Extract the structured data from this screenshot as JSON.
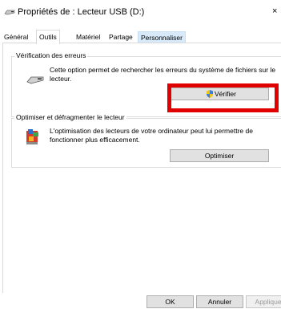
{
  "window": {
    "title": "Propriétés de : Lecteur USB (D:)",
    "close_glyph": "×"
  },
  "tabs": [
    {
      "label": "Général"
    },
    {
      "label": "Outils"
    },
    {
      "label": "Matériel"
    },
    {
      "label": "Partage"
    },
    {
      "label": "Personnaliser"
    }
  ],
  "error_check": {
    "heading": "Vérification des erreurs",
    "description": "Cette option permet de rechercher les erreurs du système de fichiers sur le lecteur.",
    "button_label": "Vérifier"
  },
  "optimize": {
    "heading": "Optimiser et défragmenter le lecteur",
    "description": "L'optimisation des lecteurs de votre ordinateur peut lui permettre de fonctionner plus efficacement.",
    "button_label": "Optimiser"
  },
  "footer": {
    "ok_label": "OK",
    "cancel_label": "Annuler",
    "apply_label": "Appliquer"
  },
  "colors": {
    "highlight": "#e00000",
    "tab_hover": "#d8eaf9"
  }
}
